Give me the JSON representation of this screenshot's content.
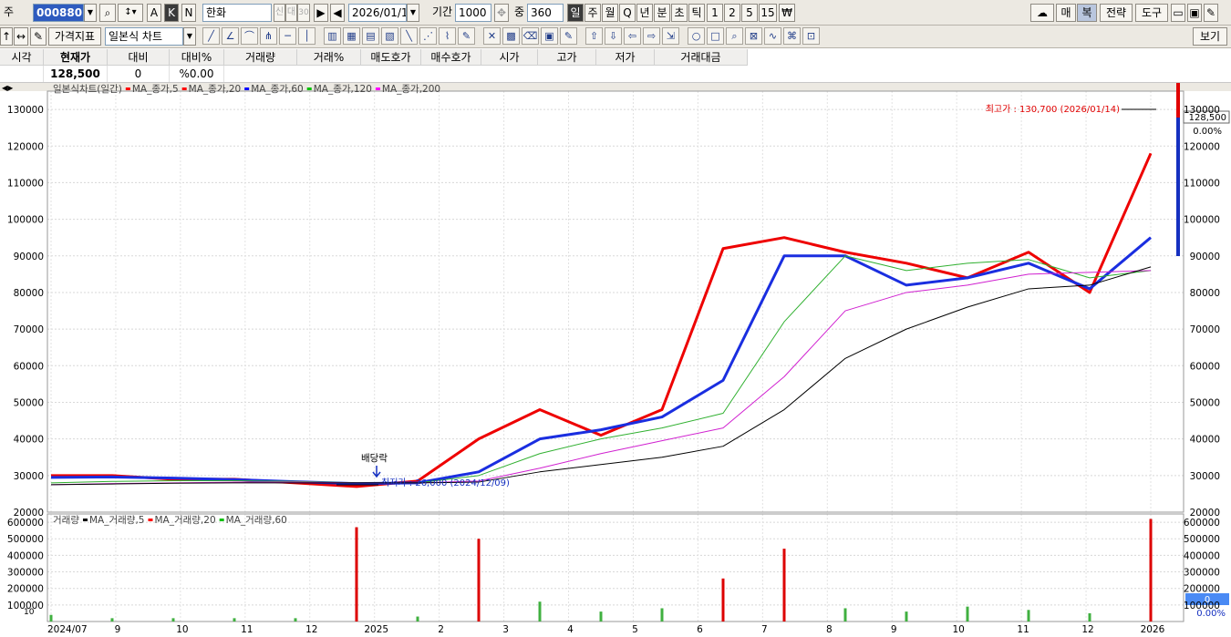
{
  "toolbar": {
    "code_prefix": "주",
    "stock_code": "000880",
    "stock_name": "한화",
    "sin_label": "신",
    "dae_label": "대",
    "num_label": "30",
    "date": "2026/01/15",
    "period_label": "기간",
    "period_value": "1000",
    "zoom_label": "중",
    "zoom_value": "360",
    "period_buttons": [
      "일",
      "주",
      "월",
      "Q",
      "년",
      "분",
      "초",
      "틱",
      "1",
      "2",
      "5",
      "15",
      "₩"
    ],
    "ak_buttons": [
      "A",
      "K",
      "N"
    ],
    "right_buttons": [
      "매",
      "복",
      "전략",
      "도구"
    ]
  },
  "toolbar2": {
    "price_indicator": "가격지표",
    "chart_type": "일본식 차트",
    "view_button": "보기"
  },
  "quote": {
    "headers": [
      "시각",
      "현재가",
      "대비",
      "대비%",
      "거래량",
      "거래%",
      "매도호가",
      "매수호가",
      "시가",
      "고가",
      "저가",
      "거래대금"
    ],
    "values": [
      "",
      "128,500",
      "0",
      "%0.00",
      "",
      "",
      "",
      "",
      "",
      "",
      "",
      ""
    ]
  },
  "chart_labels": {
    "price_legend_title": "일본식차트(일간)",
    "price_ma": [
      {
        "name": "MA_종가,5",
        "color": "#ff0000"
      },
      {
        "name": "MA_종가,20",
        "color": "#ff0000"
      },
      {
        "name": "MA_종가,60",
        "color": "#0000ff"
      },
      {
        "name": "MA_종가,120",
        "color": "#00c000"
      },
      {
        "name": "MA_종가,200",
        "color": "#ff00ff"
      }
    ],
    "volume_legend_title": "거래량",
    "volume_ma": [
      {
        "name": "MA_거래량,5",
        "color": "#000000"
      },
      {
        "name": "MA_거래량,20",
        "color": "#ff0000"
      },
      {
        "name": "MA_거래량,60",
        "color": "#00c000"
      }
    ],
    "high_annotation": "최고가 : 130,700 (2026/01/14)",
    "low_annotation": "최저가 : 26,000 (2024/12/09)",
    "dividend_label": "배당락",
    "current_price_label": "128,500",
    "change_pct_label": "0.00%",
    "volume_current_label": "0",
    "volume_pct_label": "0.00%",
    "volume_axis_unit": "10"
  },
  "chart_data": [
    {
      "type": "line",
      "title": "일본식차트(일간)",
      "ylim": [
        20000,
        135000
      ],
      "y_ticks": [
        20000,
        30000,
        40000,
        50000,
        60000,
        70000,
        80000,
        90000,
        100000,
        110000,
        120000,
        130000
      ],
      "x_ticks": [
        "2024/07",
        "9",
        "10",
        "11",
        "12",
        "2025",
        "2",
        "3",
        "4",
        "5",
        "6",
        "7",
        "8",
        "9",
        "10",
        "11",
        "12",
        "2026"
      ],
      "x": [
        "2024/07",
        "2024/08",
        "2024/09",
        "2024/10",
        "2024/11",
        "2024/12",
        "2025/01",
        "2025/02",
        "2025/03",
        "2025/04",
        "2025/05",
        "2025/06",
        "2025/07",
        "2025/08",
        "2025/09",
        "2025/10",
        "2025/11",
        "2025/12",
        "2026/01"
      ],
      "series": [
        {
          "name": "MA_종가,5",
          "values": [
            30000,
            30000,
            29000,
            29000,
            28000,
            27000,
            28500,
            40000,
            48000,
            41000,
            48000,
            92000,
            95000,
            91000,
            88000,
            84000,
            91000,
            80000,
            118000
          ]
        },
        {
          "name": "MA_종가,60",
          "values": [
            29500,
            29600,
            29300,
            28900,
            28300,
            27800,
            28000,
            31000,
            40000,
            42500,
            46000,
            56000,
            90000,
            90000,
            82000,
            84000,
            88000,
            81000,
            95000
          ]
        },
        {
          "name": "MA_종가,120",
          "values": [
            28000,
            28400,
            28600,
            28600,
            28400,
            28000,
            28000,
            30000,
            36000,
            40000,
            43000,
            47000,
            72000,
            90000,
            86000,
            88000,
            89000,
            84000,
            86000
          ]
        },
        {
          "name": "MA_종가,200",
          "values": [
            27500,
            27800,
            28000,
            28200,
            28200,
            28000,
            28000,
            28500,
            32000,
            36000,
            39500,
            43000,
            57000,
            75000,
            80000,
            82000,
            85000,
            85500,
            86000
          ]
        },
        {
          "name": "MA_종가,20",
          "values": [
            27500,
            27700,
            27900,
            28000,
            28000,
            28000,
            28000,
            28200,
            31000,
            33000,
            35000,
            38000,
            48000,
            62000,
            70000,
            76000,
            81000,
            82000,
            87000
          ]
        }
      ],
      "annotations": [
        "최고가 : 130,700 (2026/01/14)",
        "최저가 : 26,000 (2024/12/09)",
        "배당락"
      ]
    },
    {
      "type": "bar",
      "title": "거래량",
      "ylim": [
        0,
        650000
      ],
      "y_ticks": [
        100000,
        200000,
        300000,
        400000,
        500000,
        600000
      ],
      "x": [
        "2024/07",
        "2024/08",
        "2024/09",
        "2024/10",
        "2024/11",
        "2024/12",
        "2025/01",
        "2025/02",
        "2025/03",
        "2025/04",
        "2025/05",
        "2025/06",
        "2025/07",
        "2025/08",
        "2025/09",
        "2025/10",
        "2025/11",
        "2025/12",
        "2026/01"
      ],
      "series": [
        {
          "name": "거래량",
          "values": [
            40000,
            20000,
            20000,
            20000,
            20000,
            570000,
            30000,
            500000,
            120000,
            60000,
            80000,
            260000,
            440000,
            80000,
            60000,
            90000,
            70000,
            50000,
            620000
          ]
        }
      ]
    }
  ]
}
